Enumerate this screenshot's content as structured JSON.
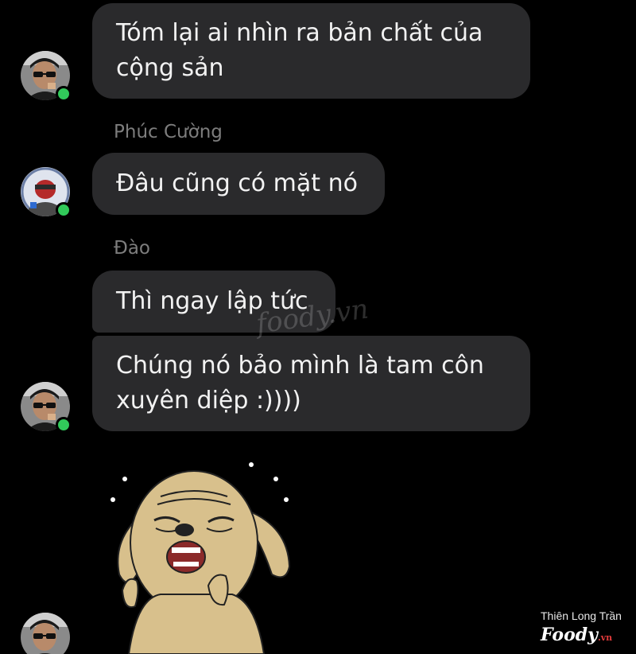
{
  "messages": [
    {
      "text": "Tóm lại ai nhìn ra bản chất của\ncộng sản"
    },
    {
      "sender": "Phúc Cường",
      "text": "Đâu cũng có mặt nó"
    },
    {
      "sender": "Đào",
      "text": "Thì ngay lập tức"
    },
    {
      "text": "Chúng nó bảo mình là tam côn\nxuyên diệp :))))"
    }
  ],
  "watermark": {
    "center": "foody.vn",
    "credit": "Thiên Long Trần",
    "brand": "Foody",
    "brand_suffix": ".vn"
  },
  "colors": {
    "background": "#000000",
    "bubble": "#2a2a2c",
    "text": "#f2f2f2",
    "sender": "#7d7d7d",
    "online": "#31c95a"
  },
  "icons": {
    "sticker": "crying-dog-sticker",
    "online": "online-status-dot"
  }
}
